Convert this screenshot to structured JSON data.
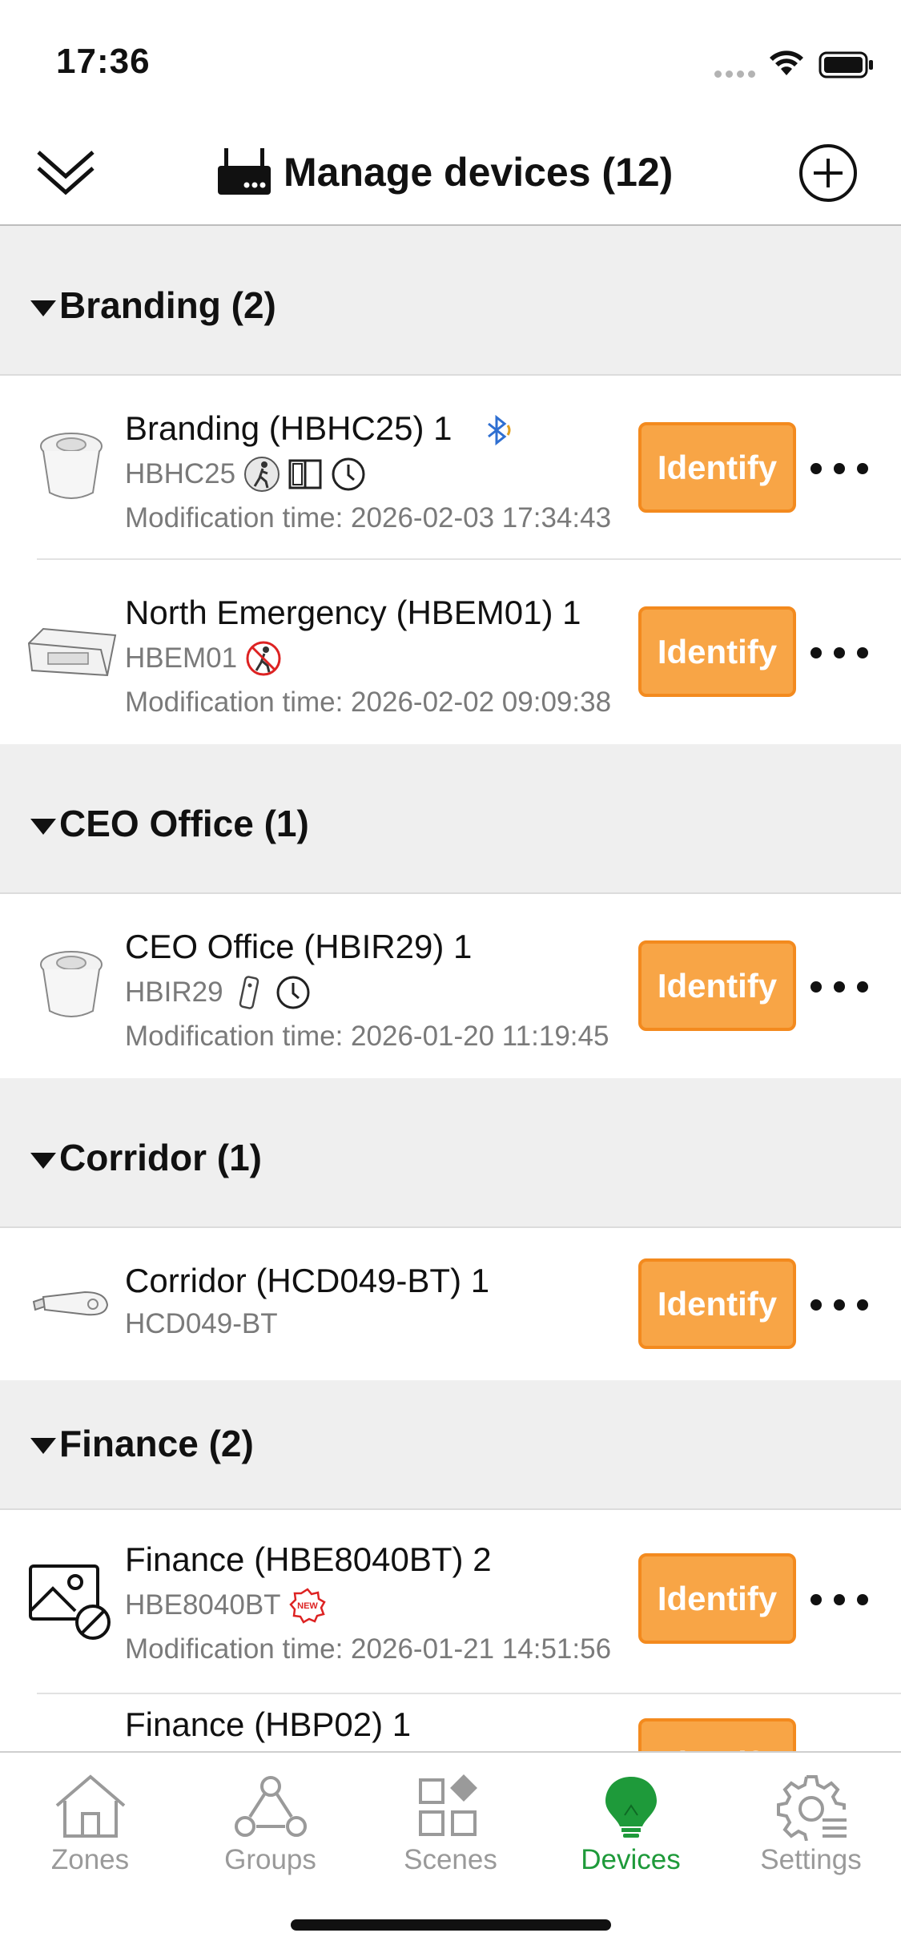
{
  "status_bar": {
    "time": "17:36"
  },
  "header": {
    "title": "Manage devices (12)"
  },
  "sections": [
    {
      "title": "Branding (2)",
      "devices": [
        {
          "name": "Branding (HBHC25) 1",
          "model": "HBHC25",
          "modified": "Modification time: 2026-02-03 17:34:43",
          "identify": "Identify"
        },
        {
          "name": "North Emergency (HBEM01) 1",
          "model": "HBEM01",
          "modified": "Modification time: 2026-02-02 09:09:38",
          "identify": "Identify"
        }
      ]
    },
    {
      "title": "CEO Office (1)",
      "devices": [
        {
          "name": "CEO Office (HBIR29) 1",
          "model": "HBIR29",
          "modified": "Modification time: 2026-01-20 11:19:45",
          "identify": "Identify"
        }
      ]
    },
    {
      "title": "Corridor (1)",
      "devices": [
        {
          "name": "Corridor (HCD049-BT) 1",
          "model": "HCD049-BT",
          "identify": "Identify"
        }
      ]
    },
    {
      "title": "Finance (2)",
      "devices": [
        {
          "name": "Finance (HBE8040BT) 2",
          "model": "HBE8040BT",
          "modified": "Modification time: 2026-01-21 14:51:56",
          "identify": "Identify"
        },
        {
          "name": "Finance (HBP02) 1",
          "identify": "Identify"
        }
      ]
    }
  ],
  "tabs": [
    {
      "label": "Zones",
      "icon": "home-icon"
    },
    {
      "label": "Groups",
      "icon": "groups-icon"
    },
    {
      "label": "Scenes",
      "icon": "scenes-icon"
    },
    {
      "label": "Devices",
      "icon": "bulb-icon",
      "active": true
    },
    {
      "label": "Settings",
      "icon": "gear-icon"
    }
  ],
  "colors": {
    "identify": "#f8a546",
    "identify_border": "#f38a1e",
    "active_tab": "#1e9a3a",
    "section_bg": "#efefef",
    "bluetooth": "#2f6fd1"
  }
}
